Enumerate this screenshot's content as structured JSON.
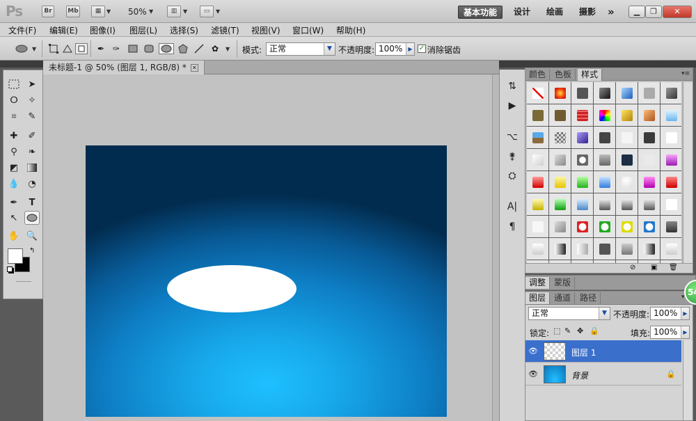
{
  "app": {
    "logo": "Ps",
    "bridge_label": "Br",
    "minibridge_label": "Mb",
    "zoom": "50%",
    "workspaces": [
      "基本功能",
      "设计",
      "绘画",
      "摄影"
    ],
    "more": "»"
  },
  "menu": [
    "文件(F)",
    "编辑(E)",
    "图像(I)",
    "图层(L)",
    "选择(S)",
    "滤镜(T)",
    "视图(V)",
    "窗口(W)",
    "帮助(H)"
  ],
  "options": {
    "mode_label": "模式:",
    "mode_value": "正常",
    "opacity_label": "不透明度:",
    "opacity_value": "100%",
    "antialias_label": "消除锯齿",
    "antialias_checked": true
  },
  "document": {
    "tab_title": "未标题-1 @ 50% (图层 1, RGB/8) *",
    "canvas_gradient": [
      "#1ec0ff",
      "#17a8ea",
      "#0e7fc6",
      "#085a96",
      "#022c4f"
    ]
  },
  "swatches_panel": {
    "tabs": [
      "颜色",
      "色板",
      "样式"
    ],
    "active_tab": "样式",
    "style_swatches": [
      "none",
      "red-glow",
      "gray-dark",
      "black-bevel",
      "blue-gloss",
      "gray-flat",
      "dark-metal",
      "olive",
      "brown",
      "red-stripe",
      "multicolor",
      "gold",
      "orange-grad",
      "lightblue-grad",
      "landscape",
      "pattern",
      "purple-3d",
      "dark-gray",
      "white-box",
      "charcoal",
      "white-outline",
      "white-bevel",
      "gray-square",
      "gray-ring",
      "gray-shade",
      "navy",
      "white-dim",
      "purple-glass",
      "red-glass",
      "yellow-glass",
      "green-glass",
      "blue-glass",
      "white-bubble",
      "magenta-glass",
      "red-bubble",
      "yellow-chrome",
      "green-chrome",
      "blue-chrome",
      "gray-chrome",
      "gray-chrome",
      "gray-chrome",
      "white-plain",
      "white-square",
      "gray-square",
      "red-frame",
      "green-frame",
      "yellow-frame",
      "blue-frame",
      "gradient-gray",
      "white-gray",
      "black-fade",
      "white-fade",
      "gray-dark",
      "gray-fade",
      "black-fade",
      "white-gray",
      "row8",
      "row8",
      "row8",
      "row8",
      "row8",
      "row8",
      "row8"
    ]
  },
  "adjust_panel": {
    "tabs": [
      "调整",
      "蒙版"
    ]
  },
  "layers_panel": {
    "tabs": [
      "图层",
      "通道",
      "路径"
    ],
    "blend_mode": "正常",
    "opacity_label": "不透明度:",
    "opacity_value": "100%",
    "lock_label": "锁定:",
    "fill_label": "填充:",
    "fill_value": "100%",
    "layers": [
      {
        "name": "图层 1",
        "selected": true
      },
      {
        "name": "背景",
        "selected": false,
        "locked": true
      }
    ]
  },
  "badge": {
    "text": "54"
  }
}
